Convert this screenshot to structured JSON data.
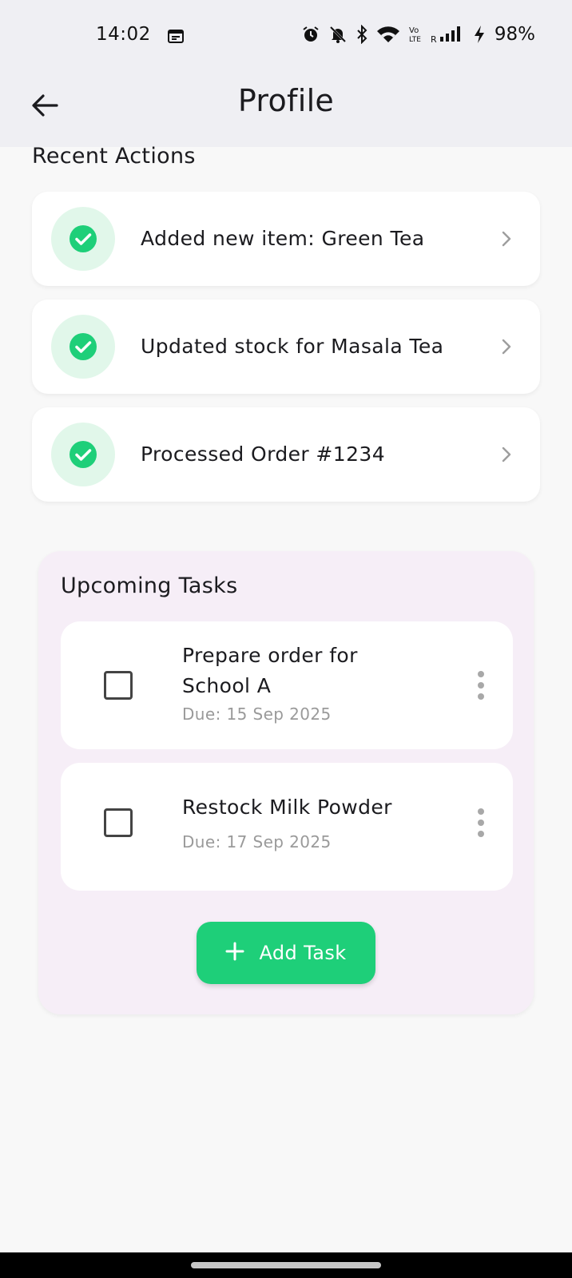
{
  "status_bar": {
    "time": "14:02",
    "volte": "Vo\nLTE",
    "roaming": "R",
    "battery": "98%",
    "icons": [
      "calendar-icon",
      "alarm-icon",
      "bell-off-icon",
      "bluetooth-icon",
      "wifi-icon",
      "volte-icon",
      "signal-icon",
      "charging-icon"
    ]
  },
  "header": {
    "title": "Profile",
    "back_icon": "arrow-left-icon"
  },
  "recent_actions": {
    "title": "Recent Actions",
    "items": [
      {
        "label": "Added new item: Green Tea"
      },
      {
        "label": "Updated stock for Masala Tea"
      },
      {
        "label": "Processed Order #1234"
      }
    ]
  },
  "upcoming_tasks": {
    "title": "Upcoming Tasks",
    "tasks": [
      {
        "title": "Prepare order for School A",
        "due": "Due: 15 Sep 2025",
        "checked": false
      },
      {
        "title": "Restock Milk Powder",
        "due": "Due: 17 Sep 2025",
        "checked": false
      }
    ],
    "add_button_label": "Add Task"
  },
  "colors": {
    "accent_green": "#1ecf79",
    "check_circle_bg": "#e1f7ea",
    "panel_bg": "#f6eef7",
    "app_bar_bg": "#efeff3"
  }
}
